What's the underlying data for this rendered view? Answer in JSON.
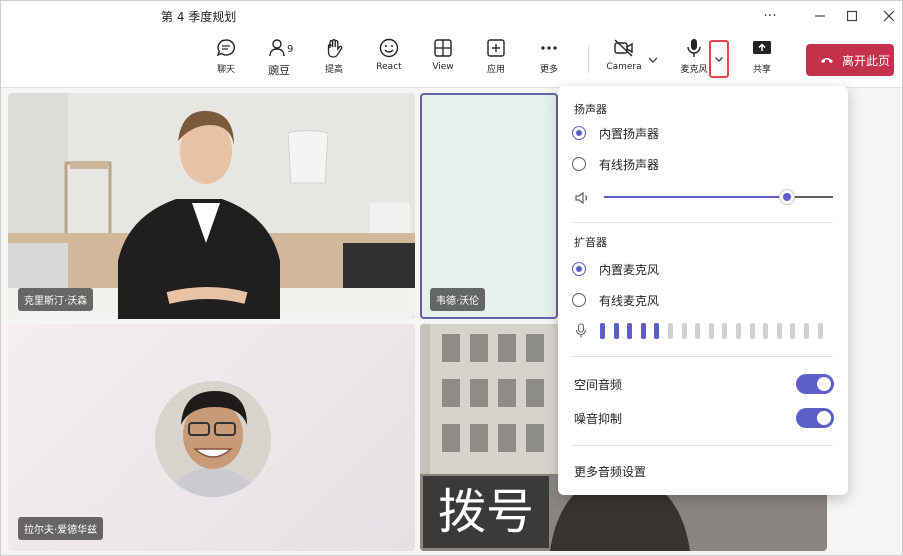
{
  "window": {
    "title": "第 4 季度规划"
  },
  "toolbar": {
    "chat": "聊天",
    "people": "豌豆",
    "people_count": "9",
    "raise_hand": "提高",
    "react": "React",
    "view": "View",
    "apps": "应用",
    "more": "更多",
    "camera": "Camera",
    "mic": "麦克风",
    "share": "共享",
    "leave": "离开此页"
  },
  "participants": [
    {
      "name": "克里斯汀·沃森"
    },
    {
      "name": "韦德·沃伦"
    },
    {
      "name": "拉尔夫·爱德华兹"
    }
  ],
  "overlay": {
    "dial_text": "拨号"
  },
  "audio_panel": {
    "speaker_section": "扬声器",
    "speakers": [
      {
        "label": "内置扬声器",
        "selected": true
      },
      {
        "label": "有线扬声器",
        "selected": false
      }
    ],
    "volume": 0.8,
    "mic_section": "扩音器",
    "mics": [
      {
        "label": "内置麦克风",
        "selected": true
      },
      {
        "label": "有线麦克风",
        "selected": false
      }
    ],
    "mic_level_bars": 17,
    "mic_level_active": 5,
    "spatial_audio": {
      "label": "空间音频",
      "on": true
    },
    "noise_suppression": {
      "label": "噪音抑制",
      "on": true
    },
    "more_settings": "更多音频设置"
  },
  "colors": {
    "accent": "#5b5fc7",
    "leave": "#c4314b",
    "highlight": "#e0474c"
  }
}
